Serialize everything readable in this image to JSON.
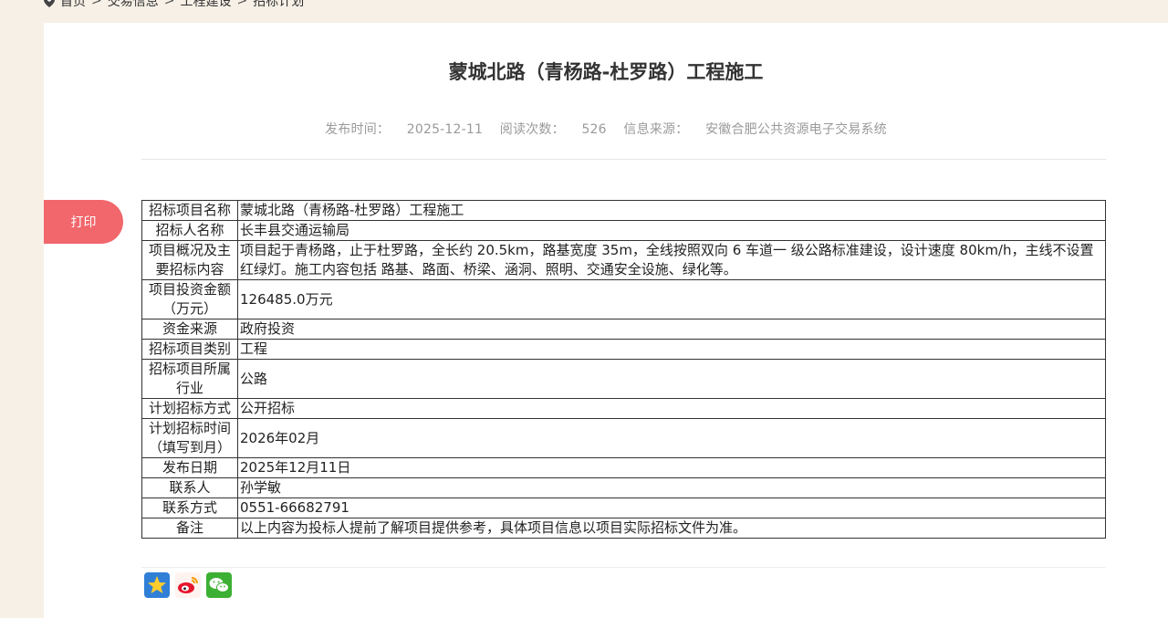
{
  "breadcrumb": [
    "首页",
    "交易信息",
    "工程建设",
    "招标计划"
  ],
  "breadcrumb_sep": ">",
  "title": "蒙城北路（青杨路-杜罗路）工程施工",
  "meta": {
    "publish_label": "发布时间：",
    "publish_value": "2025-12-11",
    "read_label": "阅读次数：",
    "read_value": "526",
    "source_label": "信息来源：",
    "source_value": "安徽合肥公共资源电子交易系统"
  },
  "print_label": "打印",
  "table": [
    {
      "k": "招标项目名称",
      "v": "蒙城北路（青杨路-杜罗路）工程施工"
    },
    {
      "k": "招标人名称",
      "v": "长丰县交通运输局"
    },
    {
      "k": "项目概况及主要招标内容",
      "v": "项目起于青杨路，止于杜罗路，全长约 20.5km，路基宽度 35m，全线按照双向 6 车道一 级公路标准建设，设计速度 80km/h，主线不设置红绿灯。施工内容包括 路基、路面、桥梁、涵洞、照明、交通安全设施、绿化等。"
    },
    {
      "k": "项目投资金额（万元）",
      "v": "126485.0万元"
    },
    {
      "k": "资金来源",
      "v": "政府投资"
    },
    {
      "k": "招标项目类别",
      "v": "工程"
    },
    {
      "k": "招标项目所属行业",
      "v": "公路"
    },
    {
      "k": "计划招标方式",
      "v": "公开招标"
    },
    {
      "k": "计划招标时间（填写到月）",
      "v": "2026年02月"
    },
    {
      "k": "发布日期",
      "v": "2025年12月11日"
    },
    {
      "k": "联系人",
      "v": "孙学敏"
    },
    {
      "k": "联系方式",
      "v": "0551-66682791"
    },
    {
      "k": "备注",
      "v": "以上内容为投标人提前了解项目提供参考，具体项目信息以项目实际招标文件为准。"
    }
  ],
  "share_icons": [
    "qzone-icon",
    "weibo-icon",
    "wechat-icon"
  ],
  "colors": {
    "print_bg": "#f1676c",
    "page_bg": "#f6f0e6"
  }
}
